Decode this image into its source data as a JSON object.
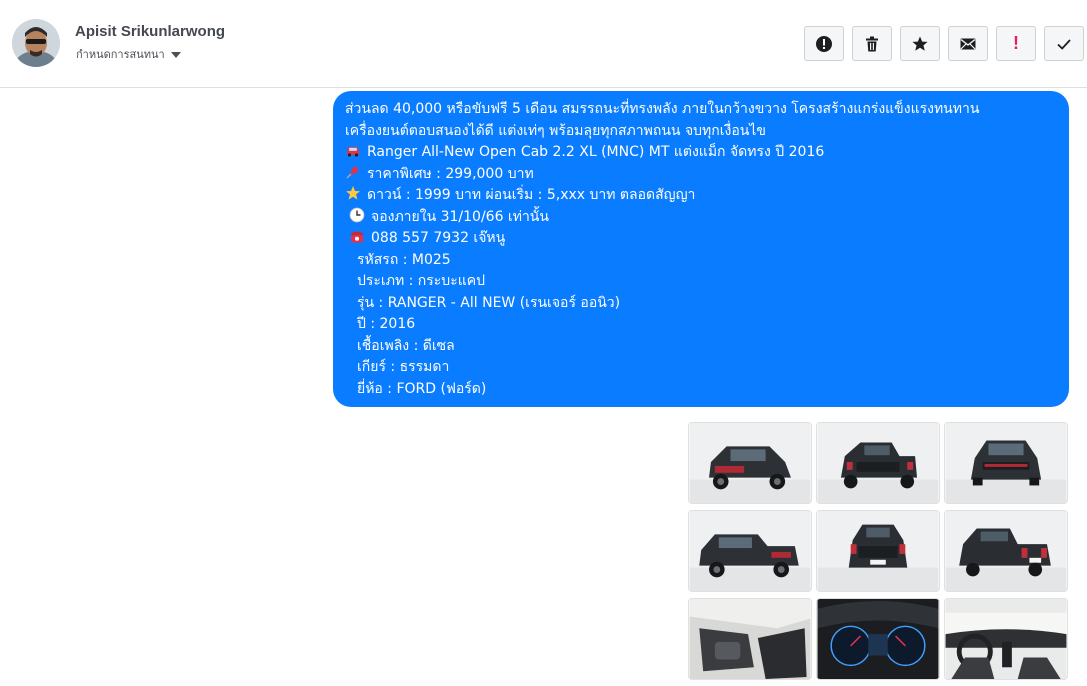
{
  "header": {
    "contact_name": "Apisit Srikunlarwong",
    "manage_label": "กำหนดการสนทนา"
  },
  "toolbar": {
    "buttons": [
      {
        "icon": "alert-circle-icon"
      },
      {
        "icon": "trash-icon"
      },
      {
        "icon": "star-icon"
      },
      {
        "icon": "mail-icon"
      },
      {
        "icon": "exclamation-icon",
        "glyph": "!",
        "color": "#e0245e"
      },
      {
        "icon": "check-icon"
      }
    ]
  },
  "message": {
    "bubble_color": "#0a7cff",
    "lines": [
      {
        "icon": null,
        "text": "ส่วนลด 40,000 หรือขับฟรี 5 เดือน สมรรถนะที่ทรงพลัง ภายในกว้างขวาง โครงสร้างแกร่งแข็งแรงทนทาน"
      },
      {
        "icon": null,
        "text": "เครื่องยนต์ตอบสนองได้ดี แต่งเท่ๆ พร้อมลุยทุกสภาพถนน จบทุกเงื่อนไข"
      },
      {
        "icon": "car-icon",
        "text": "Ranger All-New Open Cab 2.2 XL (MNC) MT แต่งแม็ก จัดทรง ปี 2016"
      },
      {
        "icon": "pushpin-icon",
        "text": "ราคาพิเศษ : 299,000 บาท"
      },
      {
        "icon": "star-icon",
        "text": "ดาวน์ : 1999 บาท ผ่อนเริ่ม : 5,xxx บาท ตลอดสัญญา"
      },
      {
        "icon": "clock-icon",
        "text": "จองภายใน 31/10/66 เท่านั้น"
      },
      {
        "icon": "telephone-icon",
        "text": "088 557 7932 เจ๊หนู"
      },
      {
        "icon": null,
        "indent": true,
        "text": "รหัสรถ : M025"
      },
      {
        "icon": null,
        "indent": true,
        "text": "ประเภท : กระบะแคป"
      },
      {
        "icon": null,
        "indent": true,
        "text": "รุ่น : RANGER - All NEW (เรนเจอร์ ออนิว)"
      },
      {
        "icon": null,
        "indent": true,
        "text": "ปี : 2016"
      },
      {
        "icon": null,
        "indent": true,
        "text": "เชื้อเพลิง : ดีเซล"
      },
      {
        "icon": null,
        "indent": true,
        "text": "เกียร์ : ธรรมดา"
      },
      {
        "icon": null,
        "indent": true,
        "text": "ยี่ห้อ : FORD (ฟอร์ด)"
      }
    ]
  },
  "gallery": {
    "photos": [
      {
        "kind": "exterior-front-angle"
      },
      {
        "kind": "exterior-rear-angle"
      },
      {
        "kind": "exterior-front"
      },
      {
        "kind": "exterior-front-side"
      },
      {
        "kind": "exterior-rear"
      },
      {
        "kind": "exterior-rear-angle"
      },
      {
        "kind": "interior-seat"
      },
      {
        "kind": "interior-dashboard"
      },
      {
        "kind": "interior-cabin"
      }
    ]
  }
}
